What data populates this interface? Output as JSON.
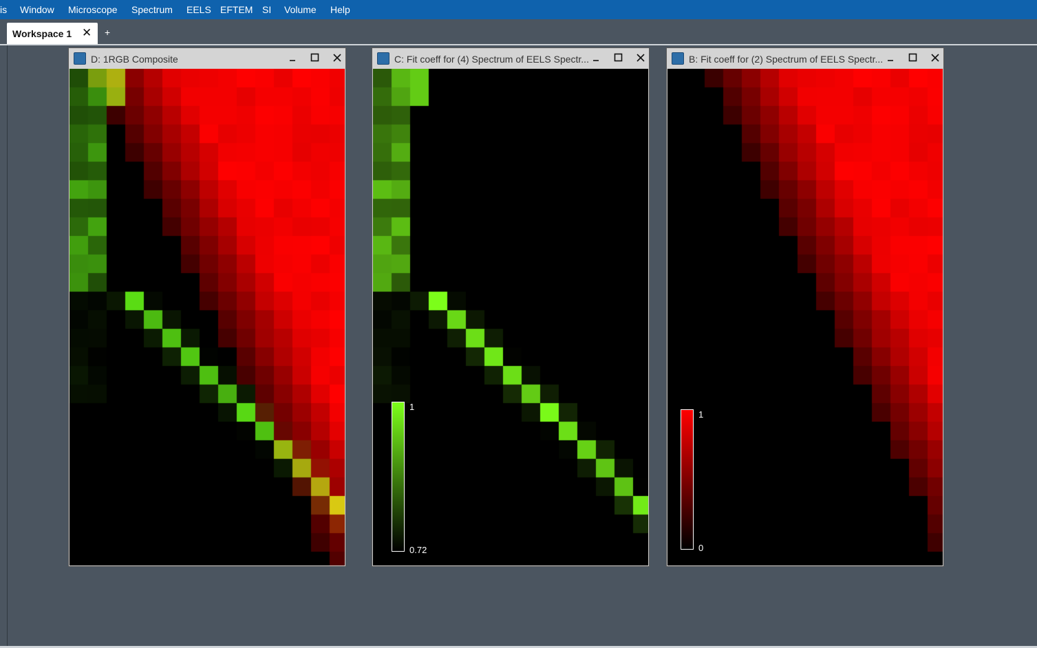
{
  "menubar": {
    "items": [
      "is",
      "Window",
      "Microscope",
      "Spectrum",
      "EELS",
      "EFTEM",
      "SI",
      "Volume",
      "Help"
    ]
  },
  "tabs": {
    "workspace_label": "Workspace 1",
    "close_glyph": "✕",
    "add_glyph": "+"
  },
  "windows": [
    {
      "title": "D: 1RGB Composite",
      "map": "composite",
      "icon": "app-icon"
    },
    {
      "title": "C: Fit coeff for (4) Spectrum of EELS Spectr...",
      "map": "green",
      "colorbar": {
        "max": "1",
        "min": "0.72",
        "color": "#7cff1a"
      }
    },
    {
      "title": "B: Fit coeff for (2) Spectrum of EELS Spectr...",
      "map": "red",
      "colorbar": {
        "max": "1",
        "min": "0",
        "color": "#ff0000"
      }
    }
  ],
  "colors": {
    "menubar": "#0f62ad",
    "workspace": "#4b5560",
    "red_max": "#ff0000",
    "green_max": "#7cff1a"
  },
  "icons": [
    "app-icon",
    "minimize-icon",
    "maximize-icon",
    "close-icon"
  ]
}
